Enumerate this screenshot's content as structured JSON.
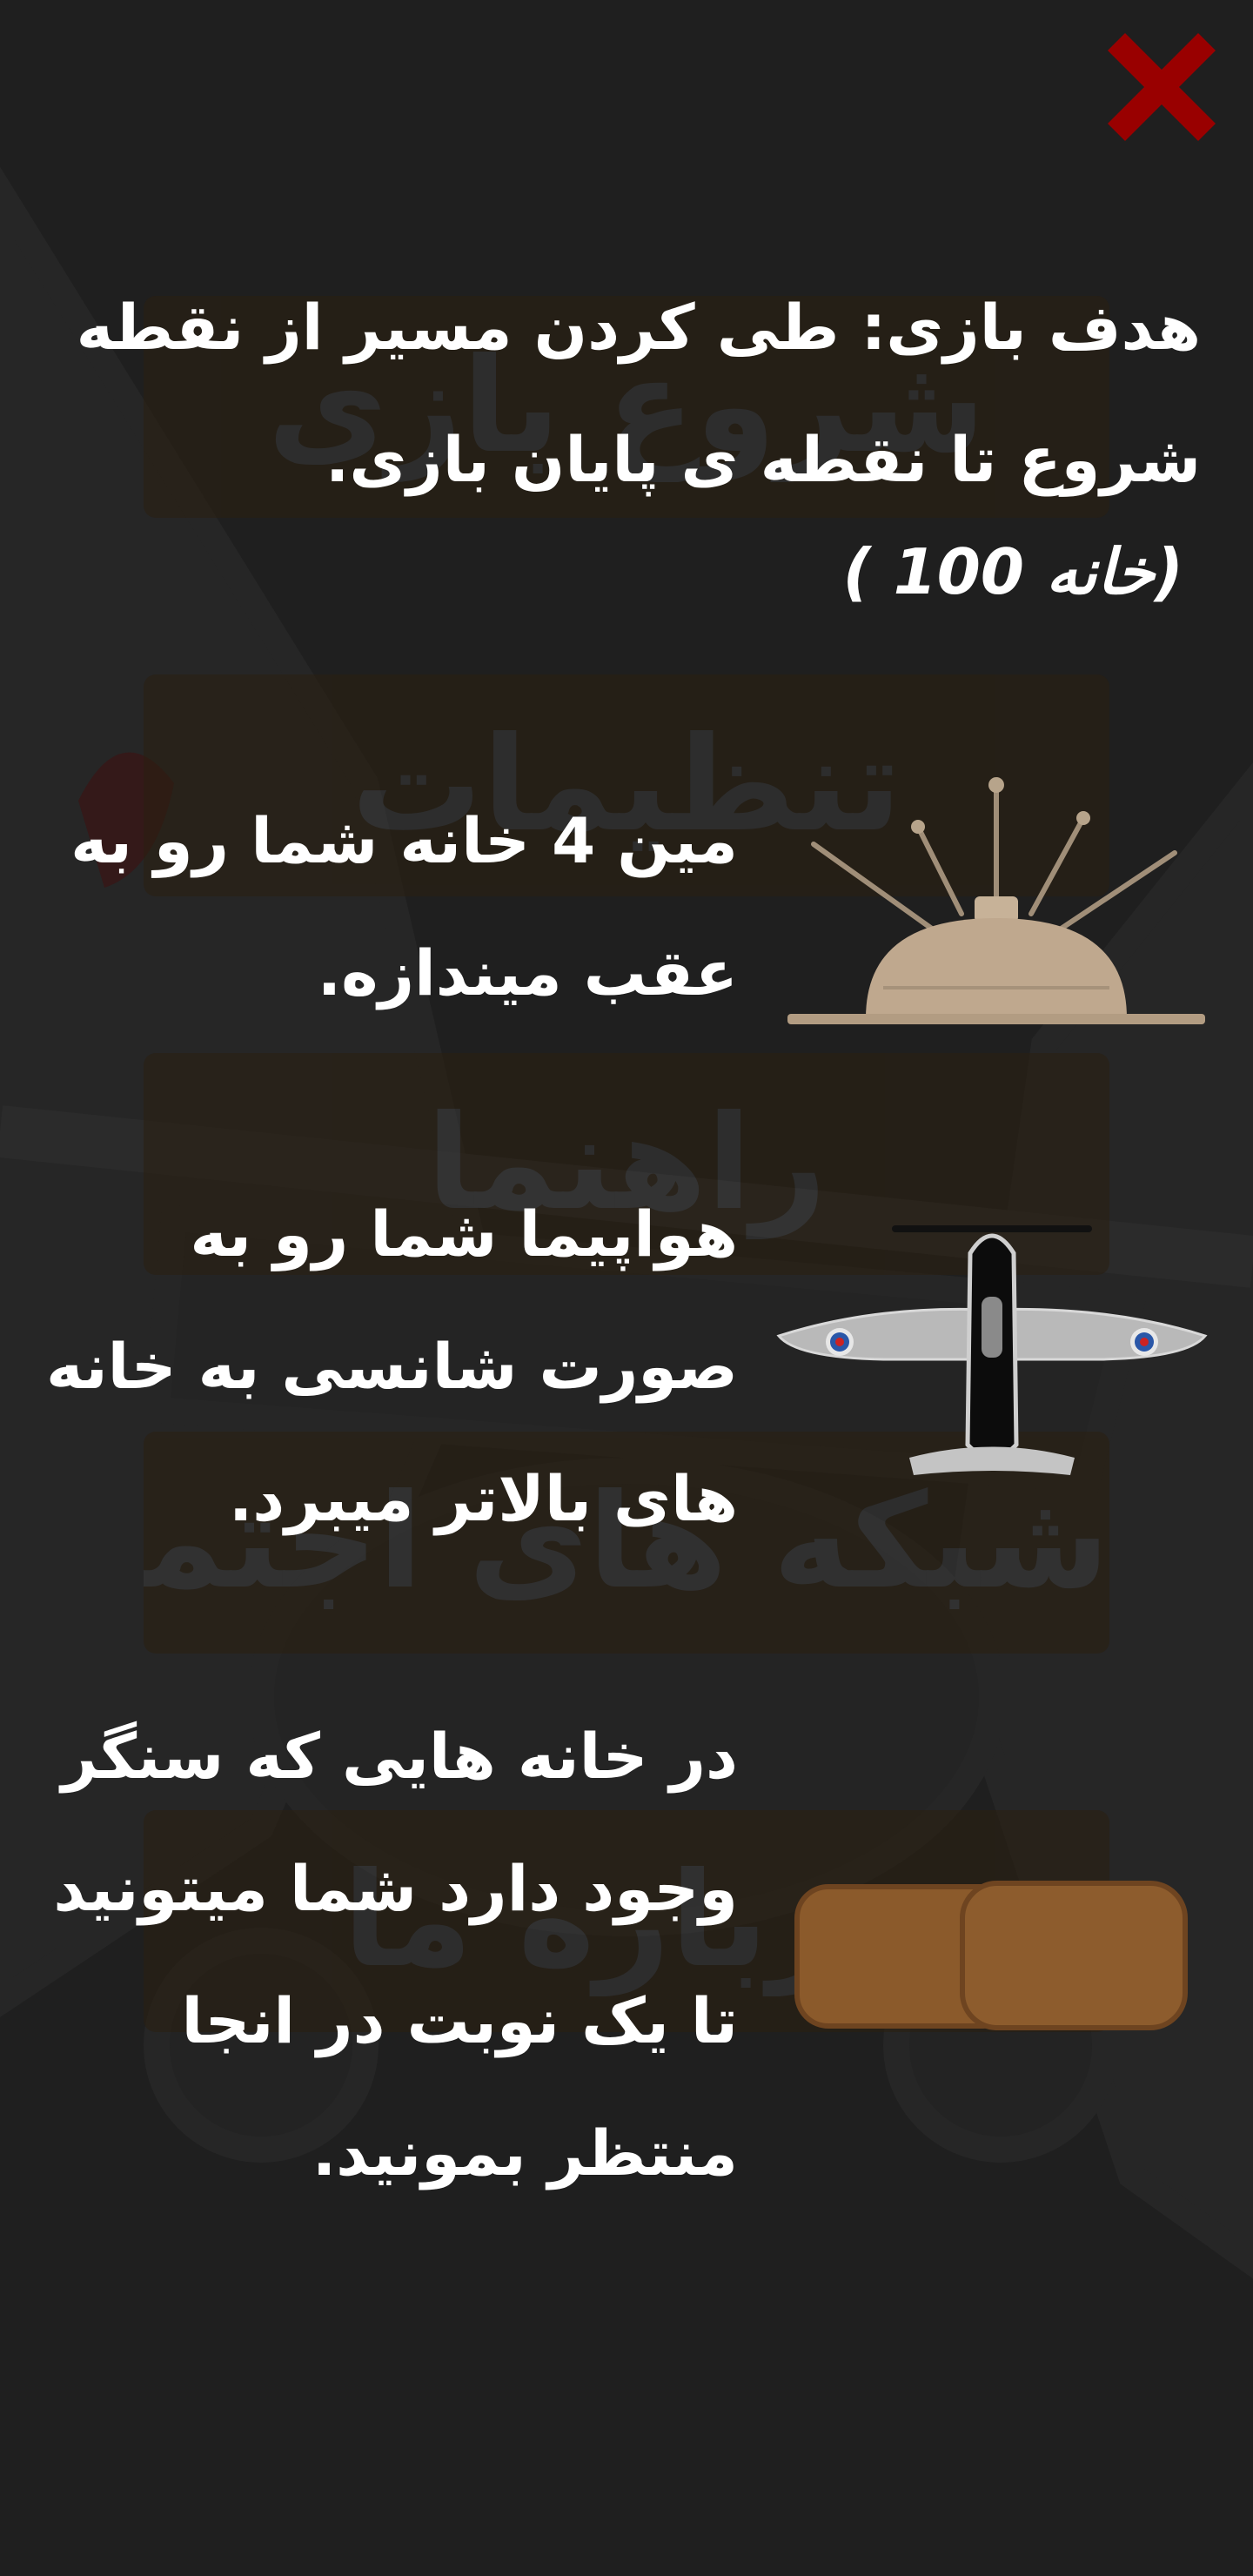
{
  "background_menu": {
    "items": [
      "شروع بازی",
      "تنظیمات",
      "راهنما",
      "شبکه های اجتماعی",
      "درباره ما"
    ]
  },
  "close_button": {
    "icon": "close-icon",
    "color": "#990000"
  },
  "goal": {
    "text": "هدف بازی: طی کردن مسیر از نقطه شروع تا نقطه ی پایان بازی.",
    "count": "( 100 خانه)"
  },
  "rules": [
    {
      "icon": "landmine-icon",
      "text": "مین 4 خانه شما رو به عقب میندازه."
    },
    {
      "icon": "airplane-icon",
      "text": "هواپیما شما رو به صورت شانسی به خانه های بالاتر میبرد."
    },
    {
      "icon": "sandbag-icon",
      "text": "در خانه هایی که سنگر وجود دارد شما میتونید تا یک نوبت در انجا منتظر بمونید."
    }
  ]
}
